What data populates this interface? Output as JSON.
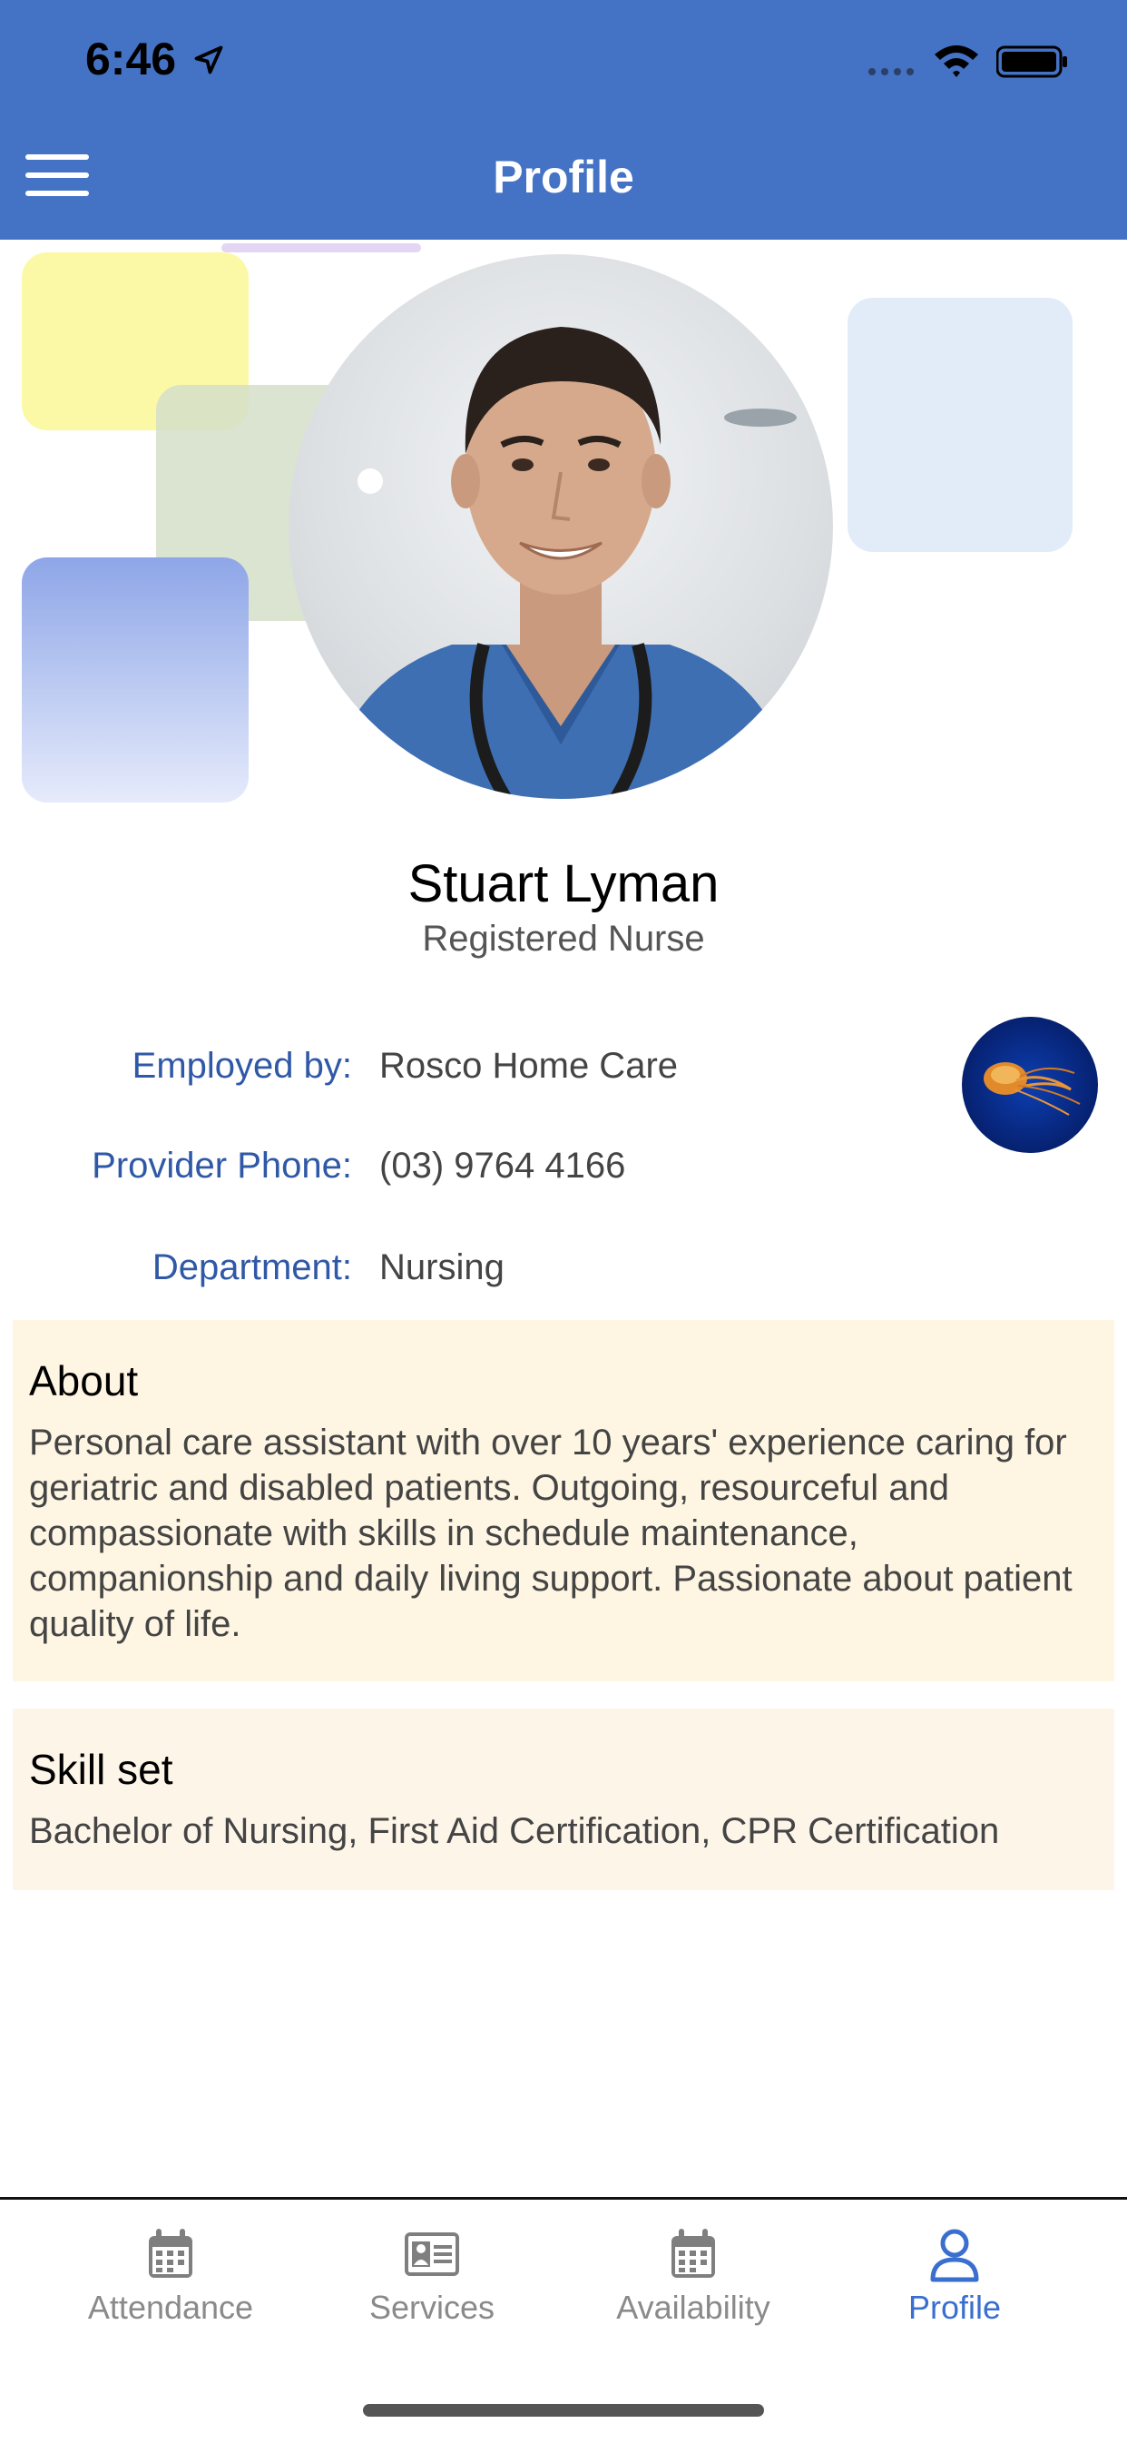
{
  "status_bar": {
    "time": "6:46"
  },
  "header": {
    "title": "Profile"
  },
  "profile": {
    "name": "Stuart Lyman",
    "role": "Registered Nurse"
  },
  "details": {
    "employed_label": "Employed by:",
    "employed_value": "Rosco Home Care",
    "phone_label": "Provider Phone:",
    "phone_value": "(03) 9764 4166",
    "department_label": "Department:",
    "department_value": "Nursing"
  },
  "about": {
    "title": "About",
    "text": "Personal care assistant with over 10 years' experience caring for geriatric and disabled patients. Outgoing, resourceful and compassionate with skills in schedule maintenance, companionship and daily living support. Passionate about patient quality of life."
  },
  "skills": {
    "title": "Skill set",
    "text": "Bachelor of Nursing, First Aid Certification, CPR Certification"
  },
  "tabs": [
    {
      "label": "Attendance",
      "icon": "calendar-icon",
      "active": false
    },
    {
      "label": "Services",
      "icon": "id-card-icon",
      "active": false
    },
    {
      "label": "Availability",
      "icon": "calendar-icon",
      "active": false
    },
    {
      "label": "Profile",
      "icon": "person-icon",
      "active": true
    }
  ],
  "colors": {
    "primary": "#4472c4",
    "label_blue": "#2f58a6",
    "active_tab": "#3a6fd0",
    "about_bg": "#fef6e3",
    "skills_bg": "#fef5e9"
  }
}
